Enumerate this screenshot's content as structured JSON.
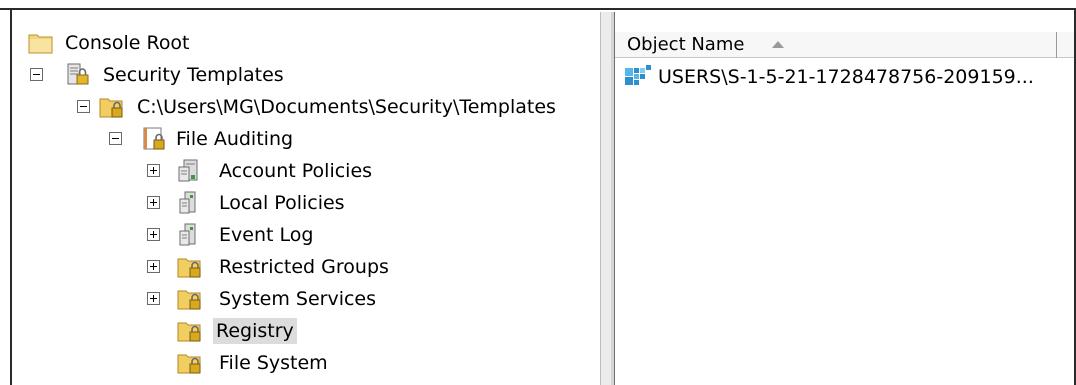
{
  "tree": {
    "console_root": "Console Root",
    "security_templates": "Security Templates",
    "template_path": "C:\\Users\\MG\\Documents\\Security\\Templates",
    "file_auditing": "File Auditing",
    "account_policies": "Account Policies",
    "local_policies": "Local Policies",
    "event_log": "Event Log",
    "restricted_groups": "Restricted Groups",
    "system_services": "System Services",
    "registry": "Registry",
    "file_system": "File System"
  },
  "list": {
    "column_object_name": "Object Name",
    "rows": [
      {
        "name": "USERS\\S-1-5-21-1728478756-209159..."
      }
    ]
  },
  "icons": {
    "folder": "folder-icon",
    "templates": "security-templates-icon",
    "locked_folder": "locked-folder-icon",
    "template_file": "template-file-icon",
    "policy": "policy-icon",
    "registry_key": "registry-key-icon"
  },
  "colors": {
    "selection": "#dcdcdc",
    "folder": "#f2cd62",
    "lock": "#d8a820",
    "registry_blue": "#2e8fd0"
  }
}
